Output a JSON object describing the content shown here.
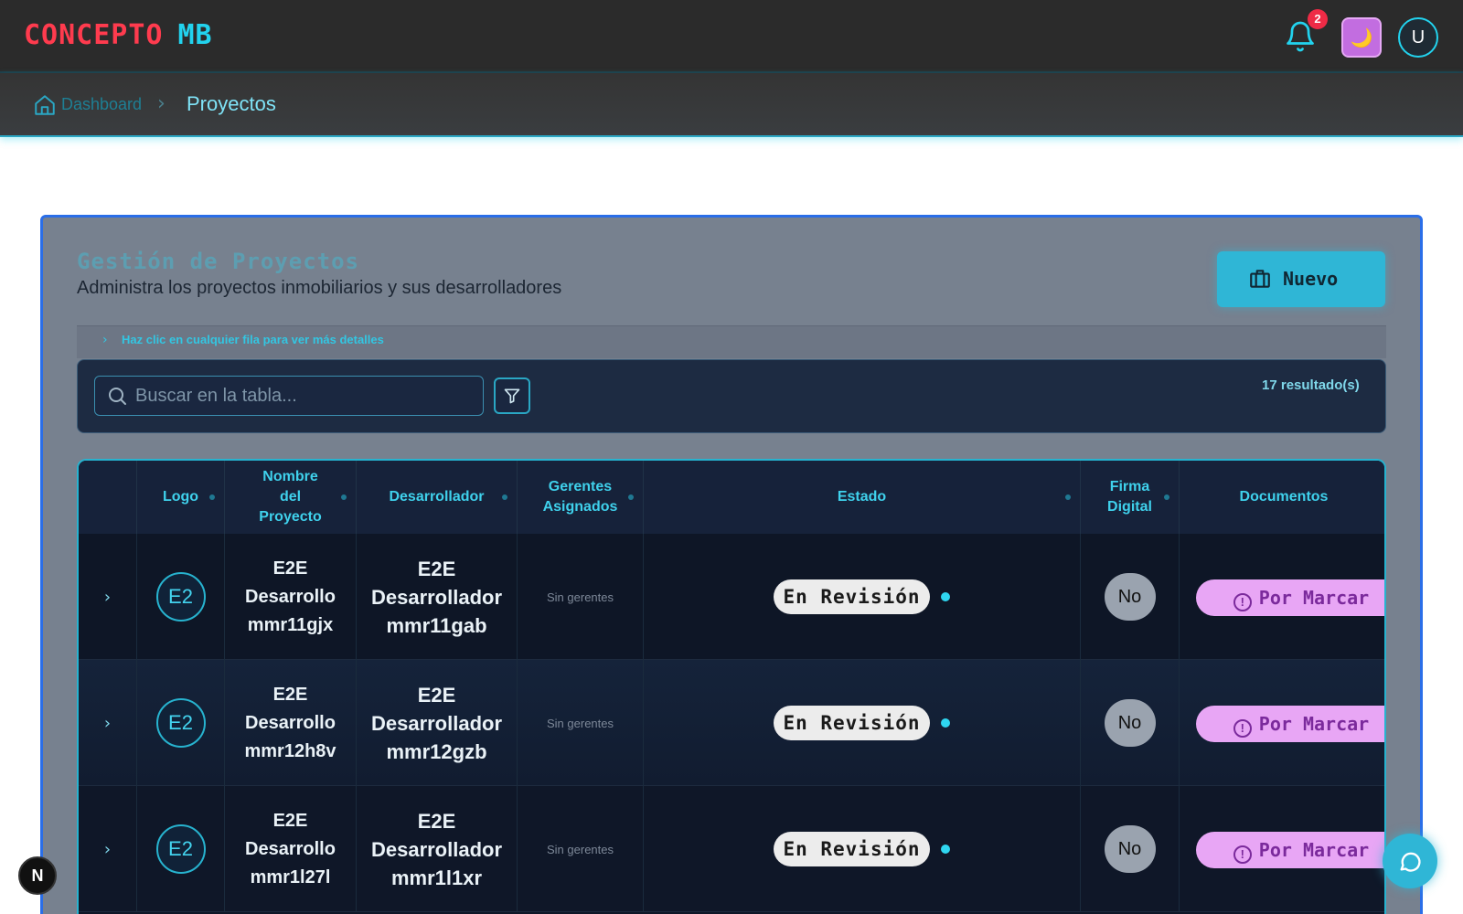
{
  "header": {
    "brand_part1": "CONCEPTO",
    "brand_part2": "MB",
    "notifications_count": "2",
    "theme_icon": "🌙",
    "avatar_initial": "U"
  },
  "breadcrumb": {
    "home_label": "Dashboard",
    "separator": "›",
    "current": "Proyectos"
  },
  "panel": {
    "title": "Gestión de Proyectos",
    "subtitle": "Administra los proyectos inmobiliarios y sus desarrolladores",
    "new_button_label": "Nuevo",
    "hint_chevron": "›",
    "hint": "Haz clic en cualquier fila para ver más detalles",
    "search_placeholder": "Buscar en la tabla...",
    "results": "17 resultado(s)"
  },
  "table": {
    "headers": {
      "logo": "Logo",
      "nombre_line1": "Nombre",
      "nombre_line2": "del",
      "nombre_line3": "Proyecto",
      "desarrollador": "Desarrollador",
      "gerentes_line1": "Gerentes",
      "gerentes_line2": "Asignados",
      "estado": "Estado",
      "firma_line1": "Firma",
      "firma_line2": "Digital",
      "documentos": "Documentos"
    },
    "rows": [
      {
        "expand": "›",
        "logo": "E2",
        "name_l1": "E2E",
        "name_l2": "Desarrollo",
        "name_l3": "mmr11gjx",
        "dev_l1": "E2E",
        "dev_l2": "Desarrollador",
        "dev_l3": "mmr11gab",
        "managers": "Sin gerentes",
        "status": "En Revisión",
        "signature": "No",
        "documents": "Por Marcar"
      },
      {
        "expand": "›",
        "logo": "E2",
        "name_l1": "E2E",
        "name_l2": "Desarrollo",
        "name_l3": "mmr12h8v",
        "dev_l1": "E2E",
        "dev_l2": "Desarrollador",
        "dev_l3": "mmr12gzb",
        "managers": "Sin gerentes",
        "status": "En Revisión",
        "signature": "No",
        "documents": "Por Marcar"
      },
      {
        "expand": "›",
        "logo": "E2",
        "name_l1": "E2E",
        "name_l2": "Desarrollo",
        "name_l3": "mmr1l27l",
        "dev_l1": "E2E",
        "dev_l2": "Desarrollador",
        "dev_l3": "mmr1l1xr",
        "managers": "Sin gerentes",
        "status": "En Revisión",
        "signature": "No",
        "documents": "Por Marcar"
      }
    ]
  },
  "misc": {
    "dev_badge": "N"
  },
  "colors": {
    "accent": "#22d3ee",
    "brand_red": "#ff3b4e",
    "panel_border": "#2a6ee8",
    "status_pill": "#ececec",
    "docs_pill": "#e8a6f5"
  }
}
